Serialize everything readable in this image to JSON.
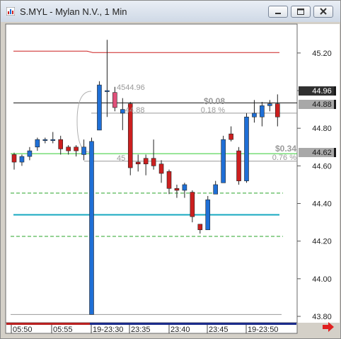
{
  "window": {
    "title": "S.MYL - Mylan N.V., 1 Min"
  },
  "icons": {
    "app": "chart-app-icon",
    "minimize": "minimize-icon",
    "restore": "restore-icon",
    "close": "close-icon",
    "scroll_right": "red-arrow-right-icon"
  },
  "colors": {
    "up_candle": "#1f6fd6",
    "down_candle": "#cc1f1f",
    "resistance_line": "#cc2020",
    "last_price_line": "#101010",
    "green_line": "#33cc33",
    "dashed_green": "#2aa52a",
    "teal_line": "#16a8c0",
    "grey_line": "#9a9a9a",
    "highlight_candle": "#e0507a"
  },
  "chart_data": {
    "type": "candlestick",
    "x_tick_labels": [
      "05:50",
      "05:55",
      "19-23:30",
      "23:35",
      "23:40",
      "23:45",
      "19-23:50"
    ],
    "y_tick_labels": [
      "45.20",
      "45.00",
      "44.80",
      "44.60",
      "44.40",
      "44.20",
      "44.00",
      "43.80"
    ],
    "ylim": [
      43.77,
      45.35
    ],
    "price_tags": [
      "44.96",
      "44.88",
      "44.62"
    ],
    "annotations": {
      "price_label_a": "4544.96",
      "price_label_b": "44.88",
      "price_label_c": "45",
      "change_a": "$0.08",
      "change_a_pct": "0.18 %",
      "change_b": "$0.34",
      "change_b_pct": "0.76 %"
    },
    "levels": {
      "resistance": 45.21,
      "last_price": 44.935,
      "grey_upper": 44.88,
      "green": 44.665,
      "grey_mid": 44.625,
      "dashed_upper": 44.455,
      "teal": 44.34,
      "dashed_lower": 44.225,
      "grey_bottom": 43.81
    },
    "candles": [
      {
        "o": 44.66,
        "h": 44.67,
        "l": 44.58,
        "c": 44.62
      },
      {
        "o": 44.62,
        "h": 44.66,
        "l": 44.6,
        "c": 44.65
      },
      {
        "o": 44.65,
        "h": 44.7,
        "l": 44.63,
        "c": 44.68
      },
      {
        "o": 44.7,
        "h": 44.75,
        "l": 44.68,
        "c": 44.74
      },
      {
        "o": 44.74,
        "h": 44.75,
        "l": 44.72,
        "c": 44.74
      },
      {
        "o": 44.74,
        "h": 44.78,
        "l": 44.72,
        "c": 44.74
      },
      {
        "o": 44.74,
        "h": 44.76,
        "l": 44.66,
        "c": 44.69
      },
      {
        "o": 44.7,
        "h": 44.71,
        "l": 44.66,
        "c": 44.68
      },
      {
        "o": 44.7,
        "h": 44.71,
        "l": 44.65,
        "c": 44.68
      },
      {
        "o": 44.66,
        "h": 44.74,
        "l": 44.63,
        "c": 44.7
      },
      {
        "o": 43.81,
        "h": 44.75,
        "l": 43.81,
        "c": 44.73
      },
      {
        "o": 44.79,
        "h": 45.05,
        "l": 44.79,
        "c": 45.03
      },
      {
        "o": 45.0,
        "h": 45.27,
        "l": 44.86,
        "c": 45.0
      },
      {
        "o": 44.99,
        "h": 45.02,
        "l": 44.89,
        "c": 44.91
      },
      {
        "o": 44.88,
        "h": 44.96,
        "l": 44.79,
        "c": 44.9
      },
      {
        "o": 44.93,
        "h": 44.94,
        "l": 44.55,
        "c": 44.59
      },
      {
        "o": 44.62,
        "h": 44.66,
        "l": 44.57,
        "c": 44.61
      },
      {
        "o": 44.64,
        "h": 44.66,
        "l": 44.55,
        "c": 44.61
      },
      {
        "o": 44.64,
        "h": 44.74,
        "l": 44.58,
        "c": 44.6
      },
      {
        "o": 44.61,
        "h": 44.63,
        "l": 44.51,
        "c": 44.56
      },
      {
        "o": 44.57,
        "h": 44.58,
        "l": 44.45,
        "c": 44.48
      },
      {
        "o": 44.48,
        "h": 44.5,
        "l": 44.43,
        "c": 44.47
      },
      {
        "o": 44.47,
        "h": 44.51,
        "l": 44.43,
        "c": 44.5
      },
      {
        "o": 44.46,
        "h": 44.47,
        "l": 44.3,
        "c": 44.33
      },
      {
        "o": 44.29,
        "h": 44.29,
        "l": 44.24,
        "c": 44.26
      },
      {
        "o": 44.26,
        "h": 44.44,
        "l": 44.26,
        "c": 44.42
      },
      {
        "o": 44.45,
        "h": 44.52,
        "l": 44.45,
        "c": 44.5
      },
      {
        "o": 44.51,
        "h": 44.76,
        "l": 44.51,
        "c": 44.74
      },
      {
        "o": 44.77,
        "h": 44.81,
        "l": 44.73,
        "c": 44.74
      },
      {
        "o": 44.68,
        "h": 44.7,
        "l": 44.5,
        "c": 44.52
      },
      {
        "o": 44.52,
        "h": 44.88,
        "l": 44.51,
        "c": 44.86
      },
      {
        "o": 44.86,
        "h": 44.95,
        "l": 44.83,
        "c": 44.88
      },
      {
        "o": 44.86,
        "h": 44.94,
        "l": 44.81,
        "c": 44.92
      },
      {
        "o": 44.92,
        "h": 44.95,
        "l": 44.89,
        "c": 44.93
      },
      {
        "o": 44.93,
        "h": 44.98,
        "l": 44.81,
        "c": 44.86
      }
    ]
  }
}
